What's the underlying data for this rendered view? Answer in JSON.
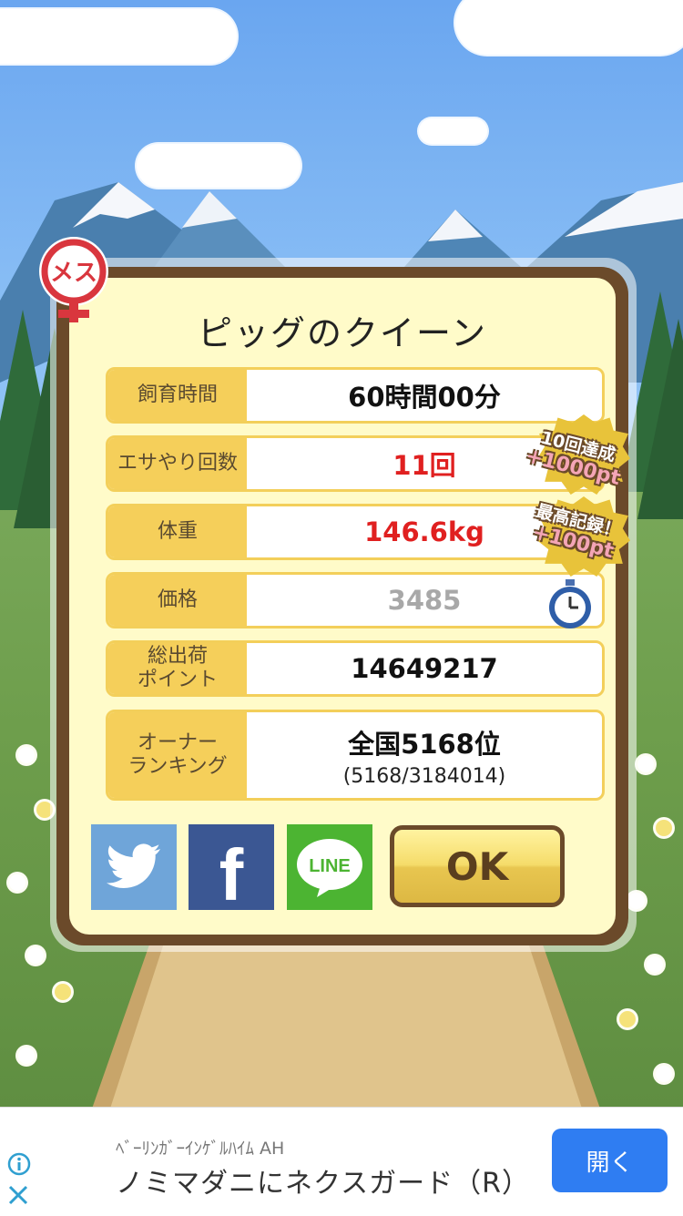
{
  "dialog": {
    "title": "ピッグのクイーン",
    "gender_badge": "メス",
    "rows": [
      {
        "label": "飼育時間",
        "value": "60時間00分"
      },
      {
        "label": "エサやり回数",
        "value": "11回"
      },
      {
        "label": "体重",
        "value": "146.6kg"
      },
      {
        "label": "価格",
        "value": "3485"
      },
      {
        "label": "総出荷\nポイント",
        "value": "14649217"
      },
      {
        "label": "オーナー\nランキング",
        "value": "全国5168位",
        "sub": "(5168/3184014)"
      }
    ],
    "badges": [
      {
        "line1": "10回達成",
        "line2": "+1000pt"
      },
      {
        "line1": "最高記録！",
        "line2": "+100pt"
      }
    ],
    "share": {
      "twitter": "twitter-icon",
      "facebook": "f",
      "line": "LINE"
    },
    "ok_label": "OK"
  },
  "ad": {
    "sponsor": "ﾍﾞｰﾘﾝｶﾞｰｲﾝｹﾞﾙﾊｲﾑ AH",
    "title": "ノミマダニにネクスガード（R）",
    "button": "開く"
  },
  "colors": {
    "accent": "#f5cf5a",
    "frame": "#6b4a2a",
    "red_value": "#e02020",
    "ad_button": "#2f7df2"
  }
}
